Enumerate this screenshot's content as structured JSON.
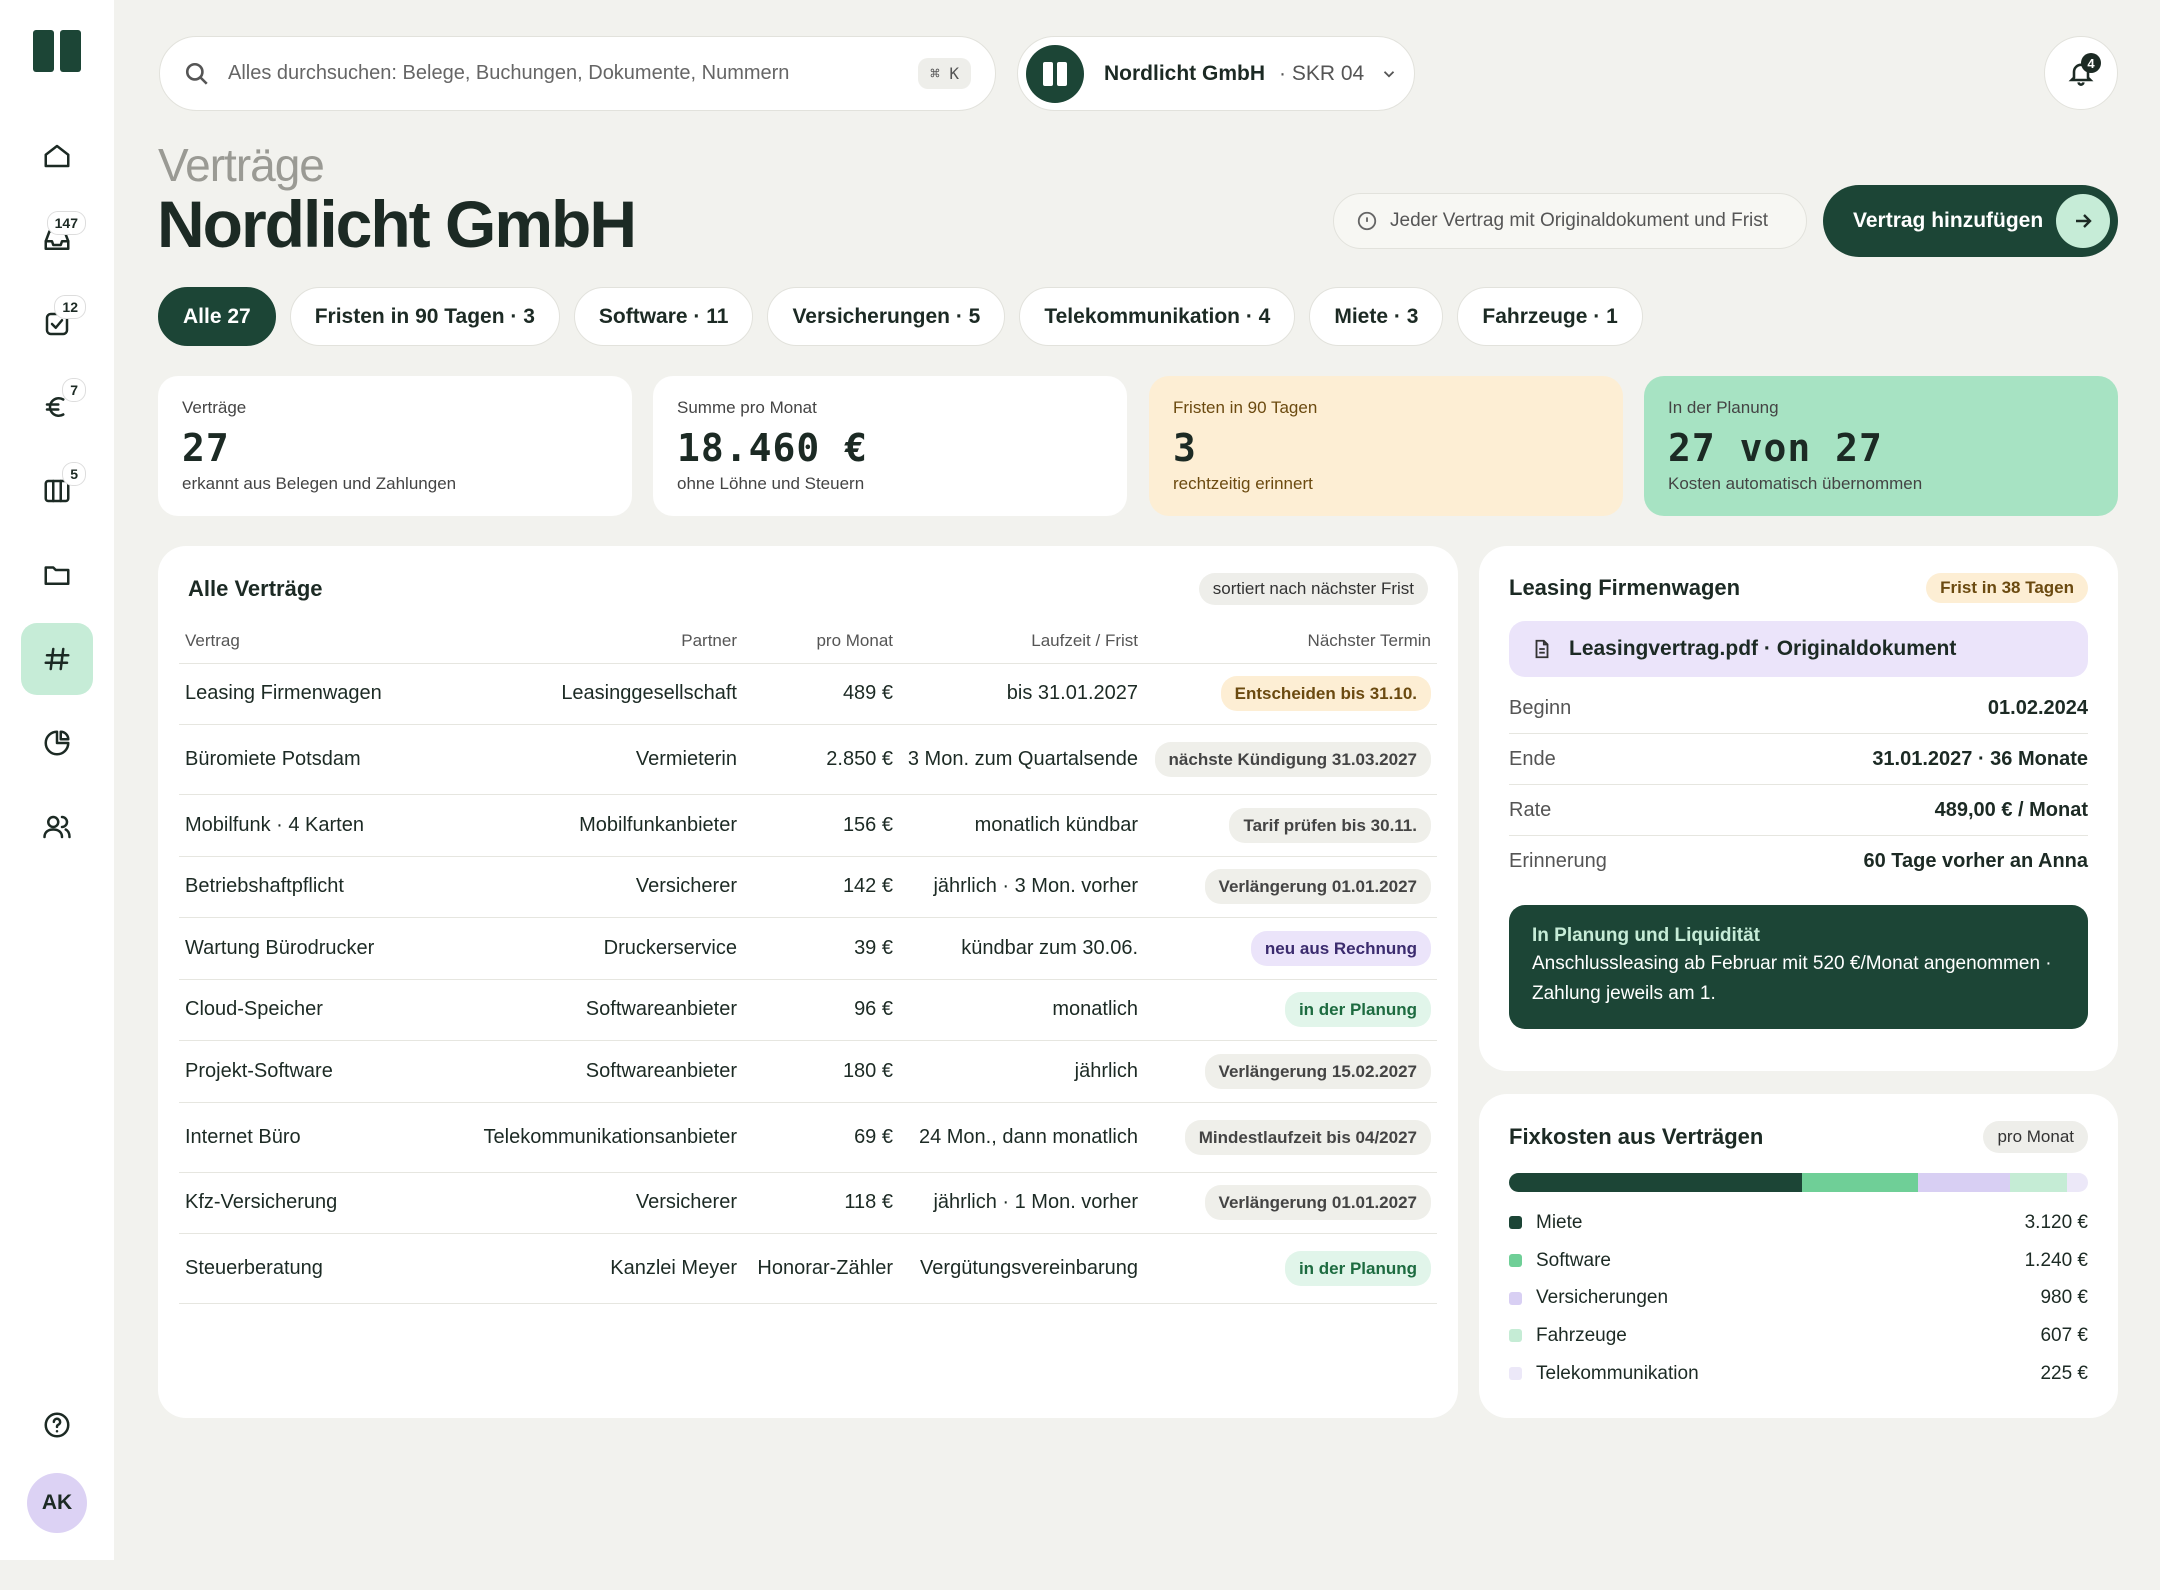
{
  "search": {
    "placeholder": "Alles durchsuchen: Belege, Buchungen, Dokumente, Nummern",
    "shortcut": "⌘ K"
  },
  "company": {
    "name": "Nordlicht GmbH",
    "chart": "· SKR 04"
  },
  "notifications": {
    "count": "4"
  },
  "nav": {
    "badges": {
      "inbox": "147",
      "tasks": "12",
      "payments": "7",
      "columns": "5"
    },
    "avatar": "AK"
  },
  "page": {
    "subtitle": "Verträge",
    "title": "Nordlicht GmbH",
    "hint": "Jeder Vertrag mit Originaldokument und Frist",
    "add_button": "Vertrag hinzufügen"
  },
  "filters": [
    "Alle 27",
    "Fristen in 90 Tagen · 3",
    "Software · 11",
    "Versicherungen · 5",
    "Telekommunikation · 4",
    "Miete · 3",
    "Fahrzeuge · 1"
  ],
  "stats": [
    {
      "label": "Verträge",
      "value": "27",
      "sub": "erkannt aus Belegen und Zahlungen"
    },
    {
      "label": "Summe pro Monat",
      "value": "18.460 €",
      "sub": "ohne Löhne und Steuern"
    },
    {
      "label": "Fristen in 90 Tagen",
      "value": "3",
      "sub": "rechtzeitig erinnert"
    },
    {
      "label": "In der Planung",
      "value": "27 von 27",
      "sub": "Kosten automatisch übernommen"
    }
  ],
  "contracts": {
    "title": "Alle Verträge",
    "sort": "sortiert nach nächster Frist",
    "columns": [
      "Vertrag",
      "Partner",
      "pro Monat",
      "Laufzeit / Frist",
      "Nächster Termin"
    ],
    "rows": [
      {
        "name": "Leasing Firmenwagen",
        "partner": "Leasinggesellschaft",
        "monthly": "489 €",
        "term": "bis 31.01.2027",
        "next": "Entscheiden bis 31.10.",
        "tag": "orange"
      },
      {
        "name": "Büromiete Potsdam",
        "partner": "Vermieterin",
        "monthly": "2.850 €",
        "term": "3 Mon. zum Quartalsende",
        "next": "nächste Kündigung 31.03.2027",
        "tag": "gray"
      },
      {
        "name": "Mobilfunk · 4 Karten",
        "partner": "Mobilfunkanbieter",
        "monthly": "156 €",
        "term": "monatlich kündbar",
        "next": "Tarif prüfen bis 30.11.",
        "tag": "gray"
      },
      {
        "name": "Betriebshaftpflicht",
        "partner": "Versicherer",
        "monthly": "142 €",
        "term": "jährlich · 3 Mon. vorher",
        "next": "Verlängerung 01.01.2027",
        "tag": "gray"
      },
      {
        "name": "Wartung Bürodrucker",
        "partner": "Druckerservice",
        "monthly": "39 €",
        "term": "kündbar zum 30.06.",
        "next": "neu aus Rechnung",
        "tag": "purple"
      },
      {
        "name": "Cloud-Speicher",
        "partner": "Softwareanbieter",
        "monthly": "96 €",
        "term": "monatlich",
        "next": "in der Planung",
        "tag": "green"
      },
      {
        "name": "Projekt-Software",
        "partner": "Softwareanbieter",
        "monthly": "180 €",
        "term": "jährlich",
        "next": "Verlängerung 15.02.2027",
        "tag": "gray"
      },
      {
        "name": "Internet Büro",
        "partner": "Telekommunikationsanbieter",
        "monthly": "69 €",
        "term": "24 Mon., dann monatlich",
        "next": "Mindestlaufzeit bis 04/2027",
        "tag": "gray"
      },
      {
        "name": "Kfz-Versicherung",
        "partner": "Versicherer",
        "monthly": "118 €",
        "term": "jährlich · 1 Mon. vorher",
        "next": "Verlängerung 01.01.2027",
        "tag": "gray"
      },
      {
        "name": "Steuerberatung",
        "partner": "Kanzlei Meyer",
        "monthly": "Honorar-Zähler",
        "term": "Vergütungsvereinbarung",
        "next": "in der Planung",
        "tag": "green"
      }
    ]
  },
  "detail": {
    "title": "Leasing Firmenwagen",
    "badge": "Frist in 38 Tagen",
    "document": "Leasingvertrag.pdf · Originaldokument",
    "fields": [
      {
        "k": "Beginn",
        "v": "01.02.2024"
      },
      {
        "k": "Ende",
        "v": "31.01.2027 · 36 Monate"
      },
      {
        "k": "Rate",
        "v": "489,00 € / Monat"
      },
      {
        "k": "Erinnerung",
        "v": "60 Tage vorher an Anna"
      }
    ],
    "planning_title": "In Planung und Liquidität",
    "planning_text": "Anschlussleasing ab Februar mit 520 €/Monat angenommen · Zahlung jeweils am 1."
  },
  "fixed_costs": {
    "title": "Fixkosten aus Verträgen",
    "period": "pro Monat",
    "items": [
      {
        "name": "Miete",
        "value": "3.120 €",
        "amount": 3120,
        "color": "#1c4536"
      },
      {
        "name": "Software",
        "value": "1.240 €",
        "amount": 1240,
        "color": "#6fcf97"
      },
      {
        "name": "Versicherungen",
        "value": "980 €",
        "amount": 980,
        "color": "#d8cff3"
      },
      {
        "name": "Fahrzeuge",
        "value": "607 €",
        "amount": 607,
        "color": "#c5ecd5"
      },
      {
        "name": "Telekommunikation",
        "value": "225 €",
        "amount": 225,
        "color": "#ece8f8"
      }
    ]
  }
}
